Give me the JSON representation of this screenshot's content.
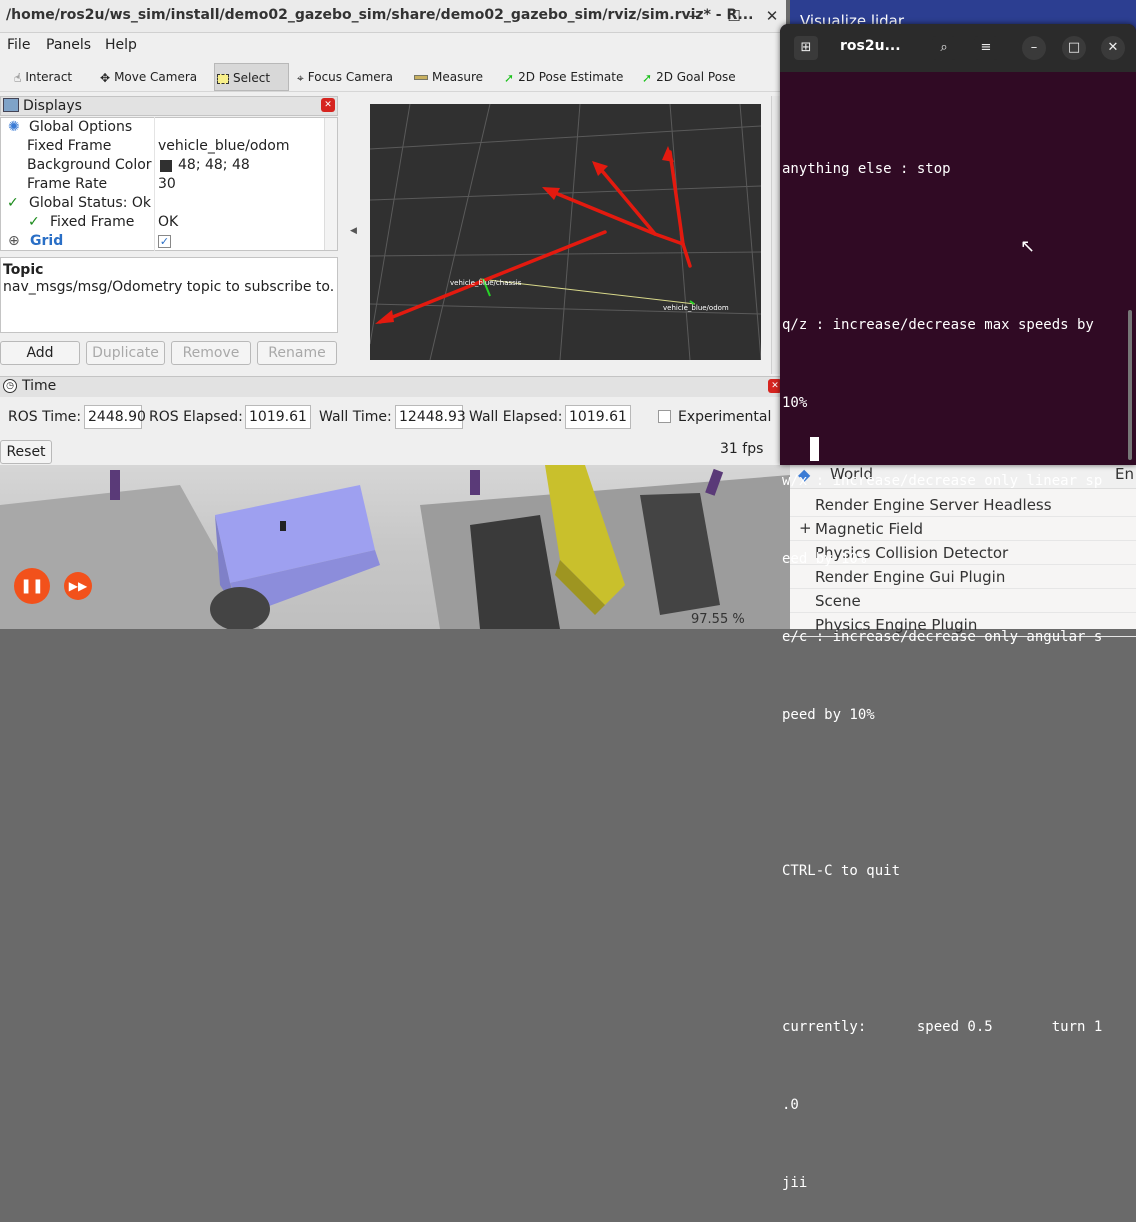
{
  "rviz": {
    "title": "/home/ros2u/ws_sim/install/demo02_gazebo_sim/share/demo02_gazebo_sim/rviz/sim.rviz* - R...",
    "menu": [
      "File",
      "Panels",
      "Help"
    ],
    "toolbar": [
      "Interact",
      "Move Camera",
      "Select",
      "Focus Camera",
      "Measure",
      "2D Pose Estimate",
      "2D Goal Pose"
    ],
    "displays": {
      "title": "Displays",
      "rows": [
        {
          "key": "Global Options",
          "value": ""
        },
        {
          "key": "Fixed Frame",
          "value": "vehicle_blue/odom"
        },
        {
          "key": "Background Color",
          "value": "48; 48; 48"
        },
        {
          "key": "Frame Rate",
          "value": "30"
        },
        {
          "key": "Global Status: Ok",
          "value": ""
        },
        {
          "key": "Fixed Frame",
          "value": "OK"
        },
        {
          "key": "Grid",
          "value": ""
        }
      ],
      "topic_title": "Topic",
      "topic_desc": "nav_msgs/msg/Odometry topic to subscribe to.",
      "buttons": [
        "Add",
        "Duplicate",
        "Remove",
        "Rename"
      ]
    },
    "view_labels": [
      "vehicle_blue/chassis",
      "vehicle_blue/odom"
    ],
    "time": {
      "title": "Time",
      "ros_time_label": "ROS Time:",
      "ros_time": "2448.90",
      "ros_elapsed_label": "ROS Elapsed:",
      "ros_elapsed": "1019.61",
      "wall_time_label": "Wall Time:",
      "wall_time": "12448.93",
      "wall_elapsed_label": "Wall Elapsed:",
      "wall_elapsed": "1019.61",
      "experimental": "Experimental",
      "reset": "Reset",
      "fps": "31 fps"
    }
  },
  "terminal": {
    "title": "ros2u...",
    "lines": [
      "anything else : stop",
      "",
      "q/z : increase/decrease max speeds by",
      "10%",
      "w/x : increase/decrease only linear sp",
      "eed by 10%",
      "e/c : increase/decrease only angular s",
      "peed by 10%",
      "",
      "CTRL-C to quit",
      "",
      "currently:      speed 0.5       turn 1",
      ".0",
      "jii"
    ]
  },
  "gazebo": {
    "panel_title": "Visualize lidar",
    "tree_title": "World",
    "tree_title_extra": "En",
    "tree_items": [
      "Render Engine Server Headless",
      "Magnetic Field",
      "Physics Collision Detector",
      "Render Engine Gui Plugin",
      "Scene",
      "Physics Engine Plugin"
    ],
    "rtf": "97.55 %"
  },
  "colors": {
    "terminal_bg": "#300a24",
    "rviz_view_bg": "#303030",
    "arrow": "#e31a0f",
    "gz_play": "#f2511b"
  }
}
